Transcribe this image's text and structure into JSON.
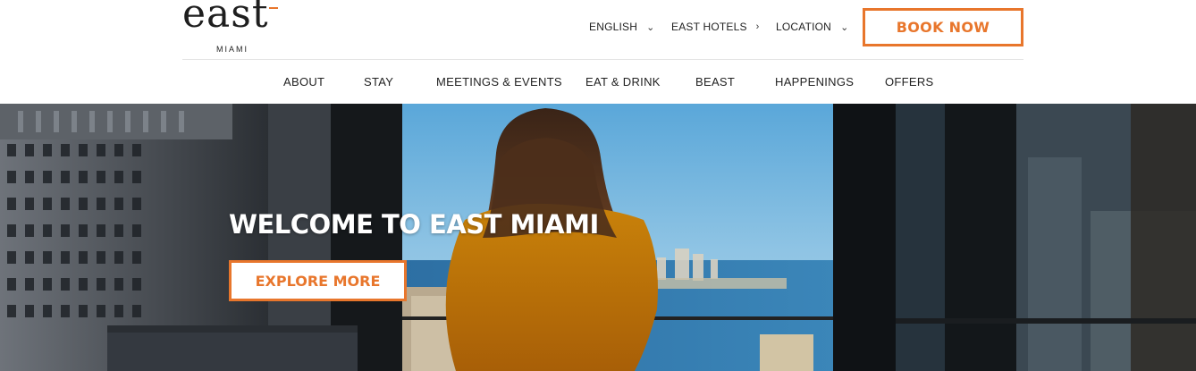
{
  "brand": {
    "logo_word": "east",
    "logo_location": "MIAMI",
    "accent_color": "#e8762c"
  },
  "utility_nav": {
    "language": "ENGLISH",
    "hotels": "EAST HOTELS",
    "location": "LOCATION"
  },
  "book_button": "BOOK NOW",
  "main_nav": [
    "ABOUT",
    "STAY",
    "MEETINGS & EVENTS",
    "EAT & DRINK",
    "BEAST",
    "HAPPENINGS",
    "OFFERS"
  ],
  "hero": {
    "title": "WELCOME TO EAST MIAMI",
    "cta": "EXPLORE MORE"
  },
  "icons": {
    "chevron_down": "chevron-down-icon",
    "chevron_right": "chevron-right-icon"
  }
}
